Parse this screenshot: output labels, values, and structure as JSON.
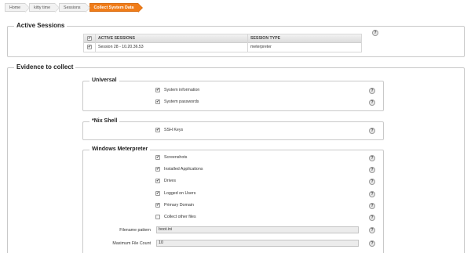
{
  "breadcrumb": [
    "Home",
    "kitty time",
    "Sessions",
    "Collect System Data"
  ],
  "active_sessions": {
    "title": "Active Sessions",
    "columns": [
      "ACTIVE SESSIONS",
      "SESSION TYPE"
    ],
    "rows": [
      {
        "checked": true,
        "session": "Session 28 - 10.20.36.53",
        "type": "meterpreter"
      }
    ]
  },
  "evidence": {
    "title": "Evidence to collect",
    "groups": {
      "universal": {
        "title": "Universal",
        "items": [
          {
            "label": "System information",
            "checked": true
          },
          {
            "label": "System passwords",
            "checked": true
          }
        ]
      },
      "nix": {
        "title": "*Nix Shell",
        "items": [
          {
            "label": "SSH Keys",
            "checked": true
          }
        ]
      },
      "windows": {
        "title": "Windows Meterpreter",
        "items": [
          {
            "label": "Screenshots",
            "checked": true
          },
          {
            "label": "Installed Applications",
            "checked": true
          },
          {
            "label": "Drives",
            "checked": true
          },
          {
            "label": "Logged on Users",
            "checked": true
          },
          {
            "label": "Primary Domain",
            "checked": true
          },
          {
            "label": "Collect other files",
            "checked": false
          }
        ],
        "fields": [
          {
            "label": "Filename pattern",
            "value": "boot.ini"
          },
          {
            "label": "Maximum File Count",
            "value": "10"
          }
        ]
      }
    }
  },
  "help_glyph": "?",
  "check_glyph": "✔",
  "colors": {
    "accent": "#f07c18"
  }
}
